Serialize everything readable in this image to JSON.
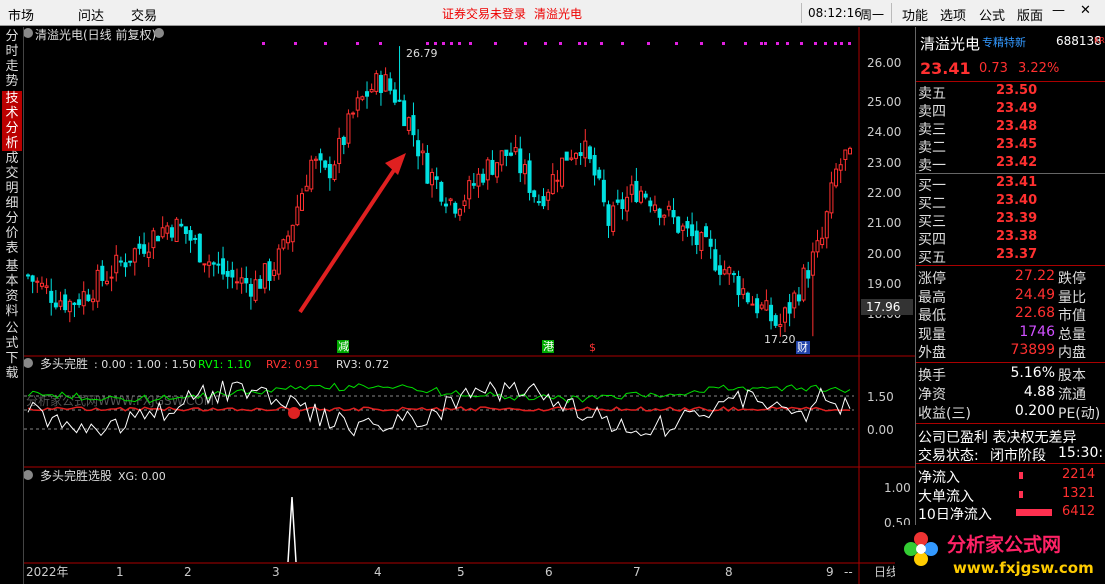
{
  "topbar": {
    "menu": [
      "市场",
      "问达",
      "交易"
    ],
    "status_msg": "证券交易未登录",
    "stock_name": "清溢光电",
    "time": "08:12:16",
    "weekday": "周一",
    "right_menu": [
      "功能",
      "选项",
      "公式",
      "版面"
    ]
  },
  "side_tabs": [
    "分时走势",
    "技术分析",
    "成交明细",
    "分价表",
    "基本资料",
    "公式下载"
  ],
  "main_chart": {
    "title": "清溢光电(日线 前复权)",
    "high_label": "26.79",
    "low_label": "17.20",
    "last_price_tag": "17.96",
    "y_ticks": [
      "26.00",
      "25.00",
      "24.00",
      "23.00",
      "22.00",
      "21.00",
      "20.00",
      "19.00",
      "18.00"
    ],
    "event_labels": [
      "减",
      "港",
      "$",
      "财"
    ]
  },
  "ind1": {
    "name": "多头完胜",
    "params": ": 0.00 : 1.00 : 1.50",
    "rv1": "RV1: 1.10",
    "rv2": "RV2: 0.91",
    "rv3": "RV3: 0.72",
    "y_ticks": [
      "1.50",
      "0.00"
    ],
    "watermark": "分析家公式网WWW.FXJGSW.COM"
  },
  "ind2": {
    "name": "多头完胜选股",
    "xg": "XG: 0.00",
    "y_ticks": [
      "1.00",
      "0.50"
    ]
  },
  "x_axis": {
    "labels": [
      "2022年",
      "1",
      "2",
      "3",
      "4",
      "5",
      "6",
      "7",
      "8",
      "9",
      "--"
    ],
    "right_label": "日线"
  },
  "quote": {
    "name": "清溢光电",
    "tag": "专精特新",
    "code": "688138",
    "kr": "KR",
    "price": "23.41",
    "change": "0.73",
    "pct": "3.22%",
    "sell": [
      {
        "label": "卖五",
        "price": "23.50"
      },
      {
        "label": "卖四",
        "price": "23.49"
      },
      {
        "label": "卖三",
        "price": "23.48"
      },
      {
        "label": "卖二",
        "price": "23.45"
      },
      {
        "label": "卖一",
        "price": "23.42"
      }
    ],
    "buy": [
      {
        "label": "买一",
        "price": "23.41"
      },
      {
        "label": "买二",
        "price": "23.40"
      },
      {
        "label": "买三",
        "price": "23.39"
      },
      {
        "label": "买四",
        "price": "23.38"
      },
      {
        "label": "买五",
        "price": "23.37"
      }
    ],
    "stats": [
      {
        "l": "涨停",
        "v": "27.22",
        "r": "跌停"
      },
      {
        "l": "最高",
        "v": "24.49",
        "r": "量比"
      },
      {
        "l": "最低",
        "v": "22.68",
        "r": "市值"
      },
      {
        "l": "现量",
        "v": "1746",
        "r": "总量"
      },
      {
        "l": "外盘",
        "v": "73899",
        "r": "内盘"
      }
    ],
    "stats2": [
      {
        "l": "换手",
        "v": "5.16%",
        "r": "股本"
      },
      {
        "l": "净资",
        "v": "4.88",
        "r": "流通"
      },
      {
        "l": "收益(三)",
        "v": "0.200",
        "r": "PE(动)"
      }
    ],
    "notice1": "公司已盈利 表决权无差异",
    "notice2_l": "交易状态:",
    "notice2_v": "闭市阶段",
    "notice2_t": "15:30:",
    "flows": [
      {
        "l": "净流入",
        "v": "2214"
      },
      {
        "l": "大单流入",
        "v": "1321"
      },
      {
        "l": "10日净流入",
        "v": "6412"
      }
    ]
  },
  "logo": {
    "text": "分析家公式网",
    "url": "www.fxjgsw.com"
  },
  "colors": {
    "up": "#ff3030",
    "down": "#00e0e0",
    "ma_green": "#00ff00",
    "bg": "#000000"
  },
  "chart_data": {
    "type": "candlestick",
    "ylim": [
      17.0,
      26.9
    ],
    "high": 26.79,
    "low": 17.2,
    "last": 23.41,
    "price_path": [
      19.2,
      18.8,
      18.5,
      18.3,
      18.6,
      19.0,
      19.4,
      19.8,
      20.2,
      20.6,
      20.9,
      20.7,
      20.1,
      19.6,
      19.2,
      19.0,
      18.9,
      19.3,
      20.0,
      21.5,
      23.0,
      22.5,
      23.4,
      24.6,
      25.3,
      25.7,
      25.1,
      24.2,
      22.8,
      22.2,
      21.6,
      21.9,
      22.6,
      23.0,
      23.3,
      22.6,
      21.7,
      22.4,
      23.2,
      23.6,
      22.5,
      20.9,
      21.6,
      22.1,
      21.8,
      21.3,
      20.8,
      20.4,
      20.0,
      19.5,
      19.0,
      18.4,
      18.0,
      17.5,
      18.4,
      19.4,
      20.3,
      22.6,
      23.41
    ]
  }
}
